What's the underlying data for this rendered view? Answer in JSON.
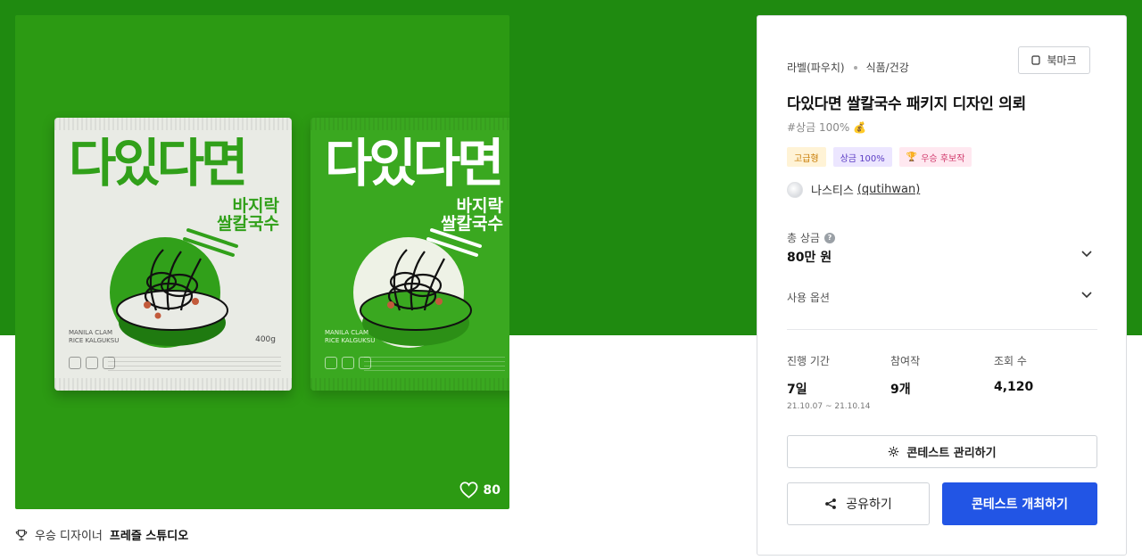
{
  "hero": {
    "likes": "80",
    "packages": {
      "brand_text": "다있다면",
      "subname_line1": "바지락",
      "subname_line2": "쌀칼국수",
      "small_line1": "MANILA CLAM",
      "small_line2": "RICE KALGUKSU",
      "weight": "400g"
    }
  },
  "award": {
    "prefix": "우승 디자이너",
    "name": "프레즐 스튜디오"
  },
  "panel": {
    "category_main": "라벨(파우치)",
    "category_sub": "식품/건강",
    "bookmark_label": "북마크",
    "title": "다있다면 쌀칼국수 패키지 디자인 의뢰",
    "hashtag": "#상금 100% 💰",
    "tags": [
      {
        "label": "고급형"
      },
      {
        "label": "상금 100%"
      },
      {
        "label": "우승 후보작"
      }
    ],
    "host_name": "나스티스",
    "host_handle": "(qutihwan)",
    "total_prize_label": "총 상금",
    "total_prize_value": "80만 원",
    "options_label": "사용 옵션",
    "stats": {
      "duration_label": "진행 기간",
      "duration_value": "7일",
      "duration_range": "21.10.07 ~ 21.10.14",
      "entries_label": "참여작",
      "entries_value": "9개",
      "views_label": "조회 수",
      "views_value": "4,120"
    },
    "manage_label": "콘테스트 관리하기",
    "share_label": "공유하기",
    "host_contest_label": "콘테스트 개최하기"
  },
  "colors": {
    "brand_green": "#1f8a10",
    "primary_blue": "#2255e5"
  }
}
